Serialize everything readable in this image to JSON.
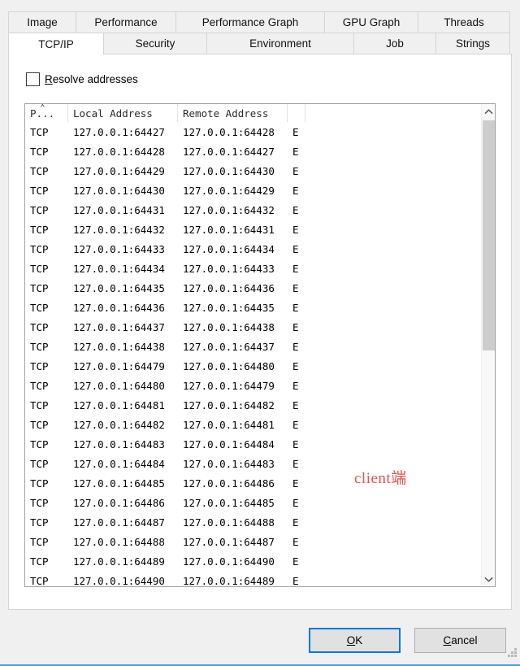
{
  "dialog": {
    "accent_color": "#0078d7",
    "bottom_accent_color": "#29a8dd"
  },
  "tabs": {
    "row1": [
      {
        "label": "Image",
        "selected": false
      },
      {
        "label": "Performance",
        "selected": false
      },
      {
        "label": "Performance Graph",
        "selected": false
      },
      {
        "label": "GPU Graph",
        "selected": false
      },
      {
        "label": "Threads",
        "selected": false
      }
    ],
    "row2": [
      {
        "label": "TCP/IP",
        "selected": true
      },
      {
        "label": "Security",
        "selected": false
      },
      {
        "label": "Environment",
        "selected": false
      },
      {
        "label": "Job",
        "selected": false
      },
      {
        "label": "Strings",
        "selected": false
      }
    ]
  },
  "options": {
    "resolve_addresses": {
      "label_before": "",
      "label_accel": "R",
      "label_after": "esolve addresses",
      "checked": false
    }
  },
  "listview": {
    "columns": [
      {
        "key": "proto",
        "label": "P...",
        "sorted": "asc"
      },
      {
        "key": "local",
        "label": "Local Address",
        "sorted": ""
      },
      {
        "key": "remote",
        "label": "Remote Address",
        "sorted": ""
      },
      {
        "key": "state",
        "label": "",
        "sorted": ""
      }
    ],
    "sort_caret": "⌃",
    "rows": [
      {
        "proto": "TCP",
        "local": "127.0.0.1:64427",
        "remote": "127.0.0.1:64428",
        "state": "E"
      },
      {
        "proto": "TCP",
        "local": "127.0.0.1:64428",
        "remote": "127.0.0.1:64427",
        "state": "E"
      },
      {
        "proto": "TCP",
        "local": "127.0.0.1:64429",
        "remote": "127.0.0.1:64430",
        "state": "E"
      },
      {
        "proto": "TCP",
        "local": "127.0.0.1:64430",
        "remote": "127.0.0.1:64429",
        "state": "E"
      },
      {
        "proto": "TCP",
        "local": "127.0.0.1:64431",
        "remote": "127.0.0.1:64432",
        "state": "E"
      },
      {
        "proto": "TCP",
        "local": "127.0.0.1:64432",
        "remote": "127.0.0.1:64431",
        "state": "E"
      },
      {
        "proto": "TCP",
        "local": "127.0.0.1:64433",
        "remote": "127.0.0.1:64434",
        "state": "E"
      },
      {
        "proto": "TCP",
        "local": "127.0.0.1:64434",
        "remote": "127.0.0.1:64433",
        "state": "E"
      },
      {
        "proto": "TCP",
        "local": "127.0.0.1:64435",
        "remote": "127.0.0.1:64436",
        "state": "E"
      },
      {
        "proto": "TCP",
        "local": "127.0.0.1:64436",
        "remote": "127.0.0.1:64435",
        "state": "E"
      },
      {
        "proto": "TCP",
        "local": "127.0.0.1:64437",
        "remote": "127.0.0.1:64438",
        "state": "E"
      },
      {
        "proto": "TCP",
        "local": "127.0.0.1:64438",
        "remote": "127.0.0.1:64437",
        "state": "E"
      },
      {
        "proto": "TCP",
        "local": "127.0.0.1:64479",
        "remote": "127.0.0.1:64480",
        "state": "E"
      },
      {
        "proto": "TCP",
        "local": "127.0.0.1:64480",
        "remote": "127.0.0.1:64479",
        "state": "E"
      },
      {
        "proto": "TCP",
        "local": "127.0.0.1:64481",
        "remote": "127.0.0.1:64482",
        "state": "E"
      },
      {
        "proto": "TCP",
        "local": "127.0.0.1:64482",
        "remote": "127.0.0.1:64481",
        "state": "E"
      },
      {
        "proto": "TCP",
        "local": "127.0.0.1:64483",
        "remote": "127.0.0.1:64484",
        "state": "E"
      },
      {
        "proto": "TCP",
        "local": "127.0.0.1:64484",
        "remote": "127.0.0.1:64483",
        "state": "E"
      },
      {
        "proto": "TCP",
        "local": "127.0.0.1:64485",
        "remote": "127.0.0.1:64486",
        "state": "E"
      },
      {
        "proto": "TCP",
        "local": "127.0.0.1:64486",
        "remote": "127.0.0.1:64485",
        "state": "E"
      },
      {
        "proto": "TCP",
        "local": "127.0.0.1:64487",
        "remote": "127.0.0.1:64488",
        "state": "E"
      },
      {
        "proto": "TCP",
        "local": "127.0.0.1:64488",
        "remote": "127.0.0.1:64487",
        "state": "E"
      },
      {
        "proto": "TCP",
        "local": "127.0.0.1:64489",
        "remote": "127.0.0.1:64490",
        "state": "E"
      },
      {
        "proto": "TCP",
        "local": "127.0.0.1:64490",
        "remote": "127.0.0.1:64489",
        "state": "E"
      }
    ]
  },
  "annotation": {
    "text": "client端",
    "color": "#e05252"
  },
  "buttons": {
    "ok": {
      "accel": "O",
      "rest": "K",
      "default": true
    },
    "cancel": {
      "accel": "C",
      "rest": "ancel",
      "default": false
    }
  }
}
